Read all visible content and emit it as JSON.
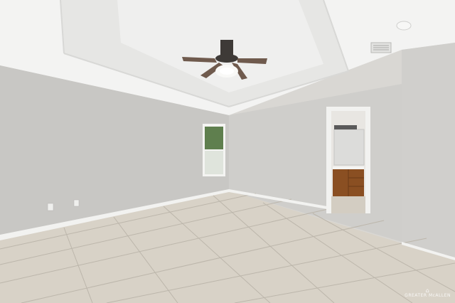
{
  "scene": {
    "subject": "empty-room-interior",
    "colors": {
      "wall_left": "#c8c7c4",
      "wall_back": "#cfcecb",
      "wall_right": "#d0cfcc",
      "ceiling": "#f3f3f2",
      "tray": "#e9e9e7",
      "floor": "#d8d2c7",
      "grout": "#bcb6ab",
      "baseboard": "#f2f2f0",
      "cabinet": "#8a4f22",
      "window_green": "#5f7f4e",
      "fan_blade": "#6f5a4d",
      "fan_body": "#3e3a37"
    }
  },
  "watermark": {
    "brand": "GREATER McALLEN",
    "icon": "house-logo-icon"
  }
}
